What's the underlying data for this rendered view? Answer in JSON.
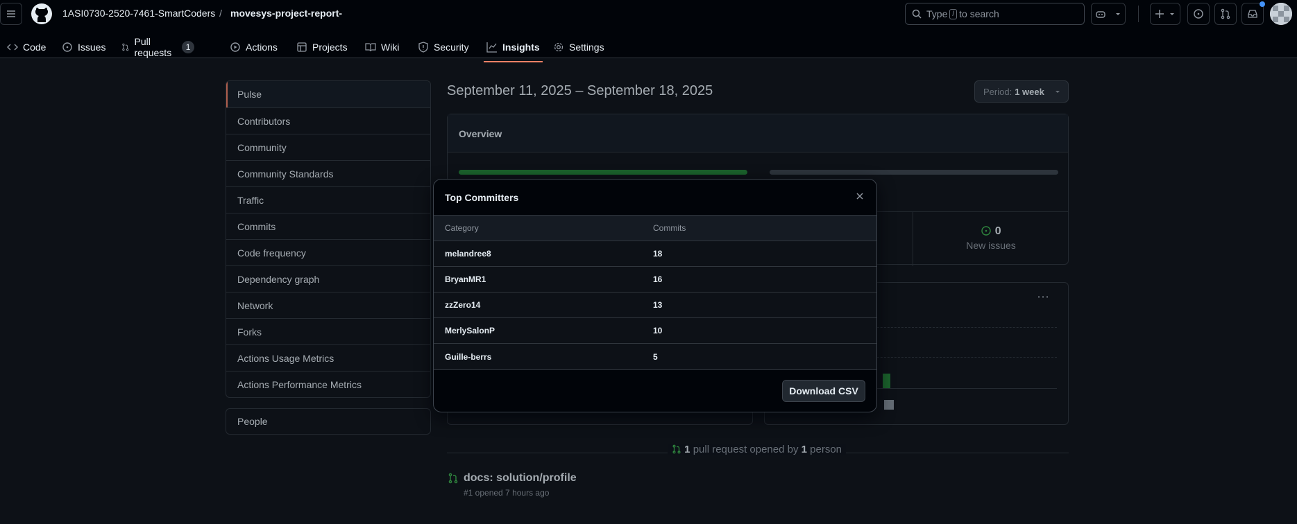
{
  "header": {
    "owner": "1ASI0730-2520-7461-SmartCoders",
    "separator": "/",
    "repo": "movesys-project-report-",
    "search_prefix": "Type",
    "search_key": "/",
    "search_suffix": "to search"
  },
  "tabs": [
    {
      "label": "Code"
    },
    {
      "label": "Issues"
    },
    {
      "label": "Pull requests",
      "count": "1"
    },
    {
      "label": "Actions"
    },
    {
      "label": "Projects"
    },
    {
      "label": "Wiki"
    },
    {
      "label": "Security"
    },
    {
      "label": "Insights"
    },
    {
      "label": "Settings"
    }
  ],
  "sidebar": {
    "items": [
      {
        "label": "Pulse"
      },
      {
        "label": "Contributors"
      },
      {
        "label": "Community"
      },
      {
        "label": "Community Standards"
      },
      {
        "label": "Traffic"
      },
      {
        "label": "Commits"
      },
      {
        "label": "Code frequency"
      },
      {
        "label": "Dependency graph"
      },
      {
        "label": "Network"
      },
      {
        "label": "Forks"
      },
      {
        "label": "Actions Usage Metrics"
      },
      {
        "label": "Actions Performance Metrics"
      }
    ],
    "people": "People"
  },
  "main": {
    "title": "September 11, 2025 – September 18, 2025",
    "period_label": "Period:",
    "period_value": "1 week",
    "overview_title": "Overview",
    "new_issues_count": "0",
    "new_issues_label": "New issues",
    "pr_summary": {
      "count": "1",
      "mid": "pull request opened by",
      "people": "1",
      "end": "person"
    },
    "pr_title": "docs: solution/profile",
    "pr_meta": "#1 opened 7 hours ago"
  },
  "modal": {
    "title": "Top Committers",
    "col_category": "Category",
    "col_commits": "Commits",
    "rows": [
      {
        "name": "melandree8",
        "commits": "18"
      },
      {
        "name": "BryanMR1",
        "commits": "16"
      },
      {
        "name": "zzZero14",
        "commits": "13"
      },
      {
        "name": "MerlySalonP",
        "commits": "10"
      },
      {
        "name": "Guille-berrs",
        "commits": "5"
      }
    ],
    "download": "Download CSV"
  },
  "colors": {
    "accent": "#f78166",
    "green": "#238636",
    "bg": "#0d1117"
  }
}
